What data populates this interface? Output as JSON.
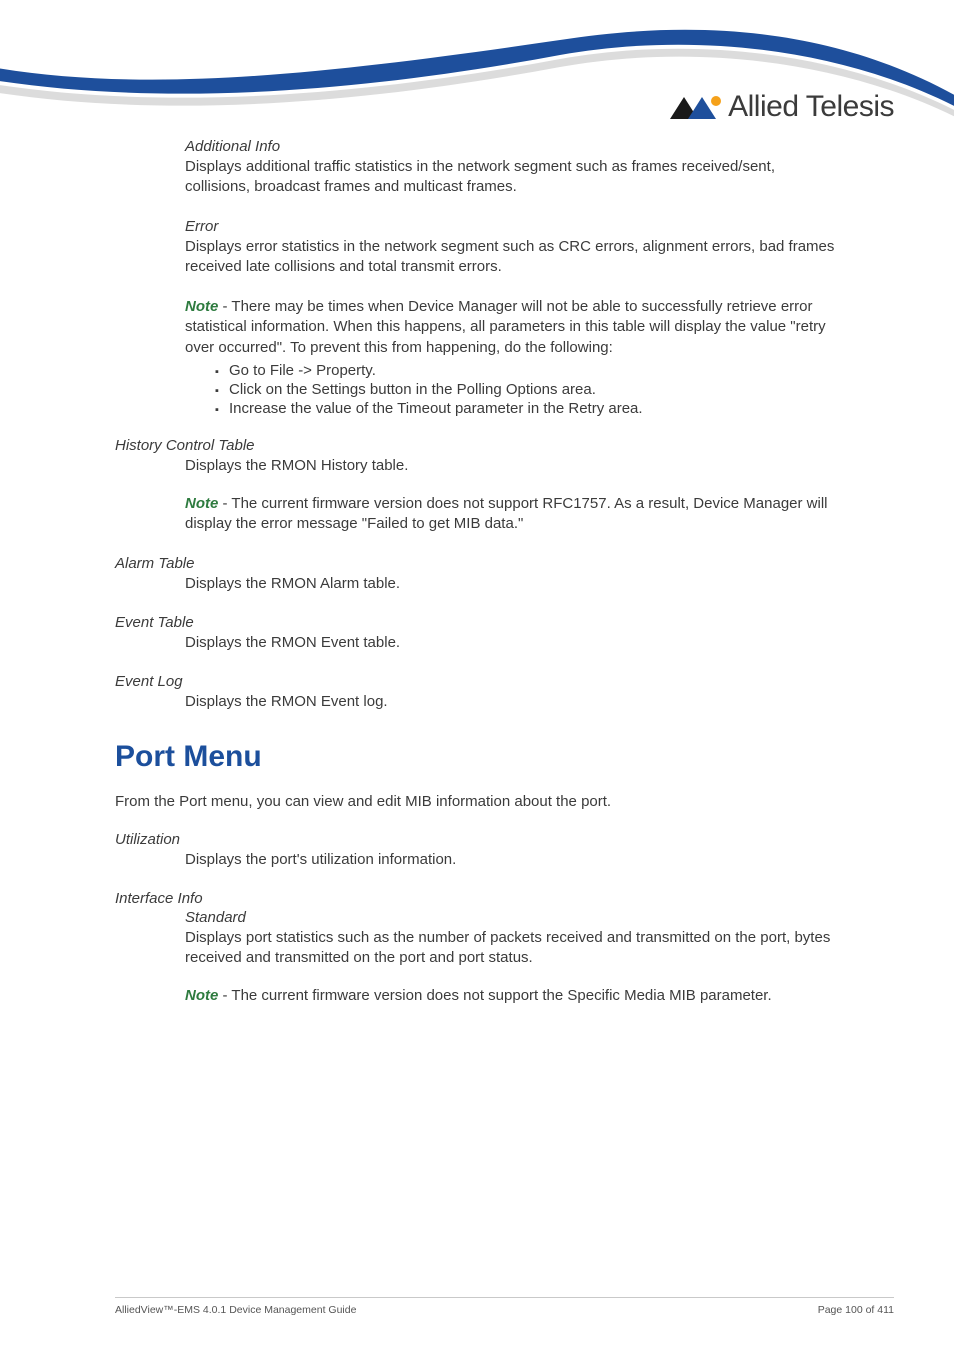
{
  "brand": {
    "name": "Allied Telesis"
  },
  "sections": {
    "additional_info": {
      "heading": "Additional Info",
      "body": "Displays additional traffic statistics in the network segment such as frames received/sent, collisions, broadcast frames and multicast frames."
    },
    "error": {
      "heading": "Error",
      "body": "Displays error statistics in the network segment such as CRC errors, alignment errors, bad frames received late collisions and total transmit errors."
    },
    "error_note": {
      "note_label": "Note",
      "body": " - There may be times when Device Manager will not be able to successfully retrieve error statistical information. When this happens, all parameters in this table will display the value \"retry over occurred\". To prevent this from happening, do the following:",
      "bullets": [
        "Go to File -> Property.",
        "Click on the Settings button in the Polling Options area.",
        "Increase the value of the Timeout parameter in the Retry area."
      ]
    },
    "history_control": {
      "heading": "History Control Table",
      "body": "Displays the RMON History table.",
      "note_label": "Note",
      "note_body": " - The current firmware version does not support RFC1757. As a result, Device Manager will display the error message \"Failed to get MIB data.\""
    },
    "alarm_table": {
      "heading": "Alarm Table",
      "body": "Displays the RMON Alarm table."
    },
    "event_table": {
      "heading": "Event Table",
      "body": "Displays the RMON Event table."
    },
    "event_log": {
      "heading": "Event Log",
      "body": "Displays the RMON Event log."
    },
    "port_menu": {
      "heading": "Port Menu",
      "intro": "From the Port menu, you can view and edit MIB information about the port."
    },
    "utilization": {
      "heading": "Utilization",
      "body": "Displays the port's utilization information."
    },
    "interface_info": {
      "heading": "Interface Info",
      "sub_heading": "Standard",
      "body": "Displays port statistics such as the number of packets received and transmitted on the port, bytes received and transmitted on the port and port status.",
      "note_label": "Note",
      "note_body": " - The current firmware version does not support the Specific Media MIB parameter."
    }
  },
  "footer": {
    "left": "AlliedView™-EMS 4.0.1 Device Management Guide",
    "right": "Page 100 of 411"
  }
}
